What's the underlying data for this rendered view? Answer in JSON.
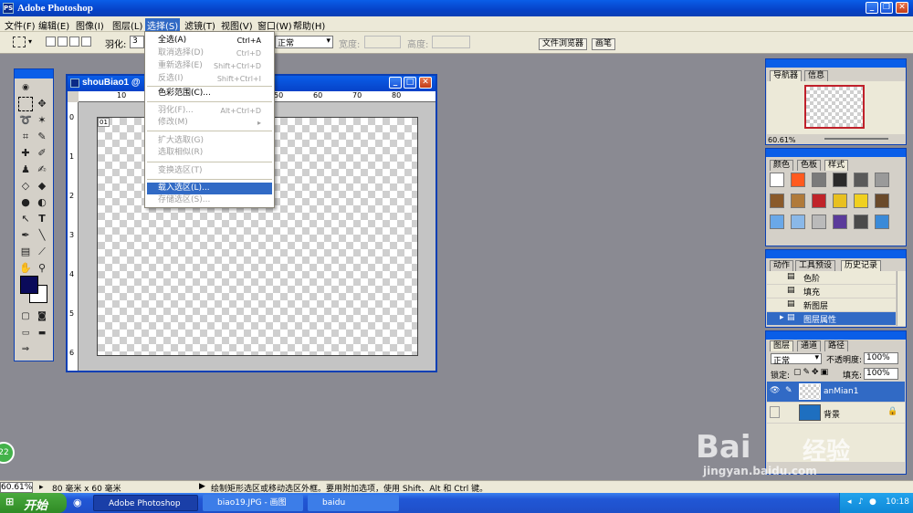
{
  "app": {
    "title": "Adobe Photoshop",
    "logo_text": "PS"
  },
  "menubar": [
    "文件(F)",
    "编辑(E)",
    "图像(I)",
    "图层(L)",
    "选择(S)",
    "滤镜(T)",
    "视图(V)",
    "窗口(W)",
    "帮助(H)"
  ],
  "options": {
    "feather_label": "羽化:",
    "feather_value": "3",
    "style_value": "正常",
    "width_label": "宽度:",
    "height_label": "高度:",
    "tab_file_browser": "文件浏览器",
    "tab_brushes": "画笔"
  },
  "select_menu": {
    "items": [
      {
        "label": "全选(A)",
        "shortcut": "Ctrl+A",
        "state": "enabled"
      },
      {
        "label": "取消选择(D)",
        "shortcut": "Ctrl+D",
        "state": "disabled"
      },
      {
        "label": "重新选择(E)",
        "shortcut": "Shift+Ctrl+D",
        "state": "disabled"
      },
      {
        "label": "反选(I)",
        "shortcut": "Shift+Ctrl+I",
        "state": "disabled"
      },
      {
        "label": "色彩范围(C)...",
        "shortcut": "",
        "state": "enabled"
      },
      {
        "label": "羽化(F)...",
        "shortcut": "Alt+Ctrl+D",
        "state": "disabled"
      },
      {
        "label": "修改(M)",
        "shortcut": "▸",
        "state": "disabled"
      },
      {
        "label": "扩大选取(G)",
        "shortcut": "",
        "state": "disabled"
      },
      {
        "label": "选取相似(R)",
        "shortcut": "",
        "state": "disabled"
      },
      {
        "label": "变换选区(T)",
        "shortcut": "",
        "state": "disabled"
      },
      {
        "label": "载入选区(L)...",
        "shortcut": "",
        "state": "highlighted"
      },
      {
        "label": "存储选区(S)...",
        "shortcut": "",
        "state": "disabled"
      }
    ]
  },
  "document": {
    "title": "shouBiao1 @",
    "ruler_h_labels": [
      "10",
      "20",
      "30",
      "40",
      "50",
      "60",
      "70",
      "80"
    ],
    "ruler_v_labels": [
      "0",
      "1",
      "2",
      "3",
      "4",
      "5",
      "6"
    ],
    "corner_label": "01"
  },
  "navigator_panel": {
    "tabs": [
      "导航器",
      "信息"
    ],
    "zoom": "60.61%"
  },
  "styles_panel": {
    "tabs": [
      "颜色",
      "色板",
      "样式"
    ],
    "swatch_colors": [
      "#ffffff",
      "#ff5a1e",
      "#7a7a7a",
      "#2a2a2a",
      "#5a5a5a",
      "#9a9a9a",
      "#8a5a2a",
      "#b07a3a",
      "#c0242a",
      "#e8c020",
      "#f0d020",
      "#6a4a2a",
      "#6aa8e8",
      "#8ab8e8",
      "#bababa",
      "#5a3a9a",
      "#4a4a4a",
      "#3a8ad8"
    ]
  },
  "history_panel": {
    "tabs": [
      "动作",
      "工具预设",
      "历史记录"
    ],
    "items": [
      "色阶",
      "填充",
      "新图层",
      "图层属性"
    ],
    "active_index": 3
  },
  "layers_panel": {
    "tabs": [
      "图层",
      "通道",
      "路径"
    ],
    "blend_mode": "正常",
    "opacity_label": "不透明度:",
    "opacity_value": "100%",
    "lock_label": "锁定:",
    "fill_label": "填充:",
    "fill_value": "100%",
    "layers": [
      {
        "name": "anMian1",
        "active": true
      },
      {
        "name": "背景",
        "active": false
      }
    ]
  },
  "statusbar": {
    "zoom": "60.61%",
    "doc_size": "80 毫米 x 60 毫米",
    "hint": "绘制矩形选区或移动选区外框。要用附加选项，使用 Shift、Alt 和 Ctrl 键。"
  },
  "taskbar": {
    "start": "开始",
    "tasks": [
      "Adobe Photoshop",
      "biao19.JPG - 画图",
      "baidu"
    ],
    "clock": "10:18"
  },
  "watermark": {
    "brand": "Bai",
    "brand2": "经验",
    "url": "jingyan.baidu.com",
    "badge": "22"
  },
  "colors": {
    "xp_blue": "#0a5ee8",
    "menu_highlight": "#316ac5",
    "foreground": "#0a0a5a",
    "background": "#ffffff",
    "layer_highlight": "#316ac5",
    "bg_layer_fill": "#1e6fc0"
  }
}
